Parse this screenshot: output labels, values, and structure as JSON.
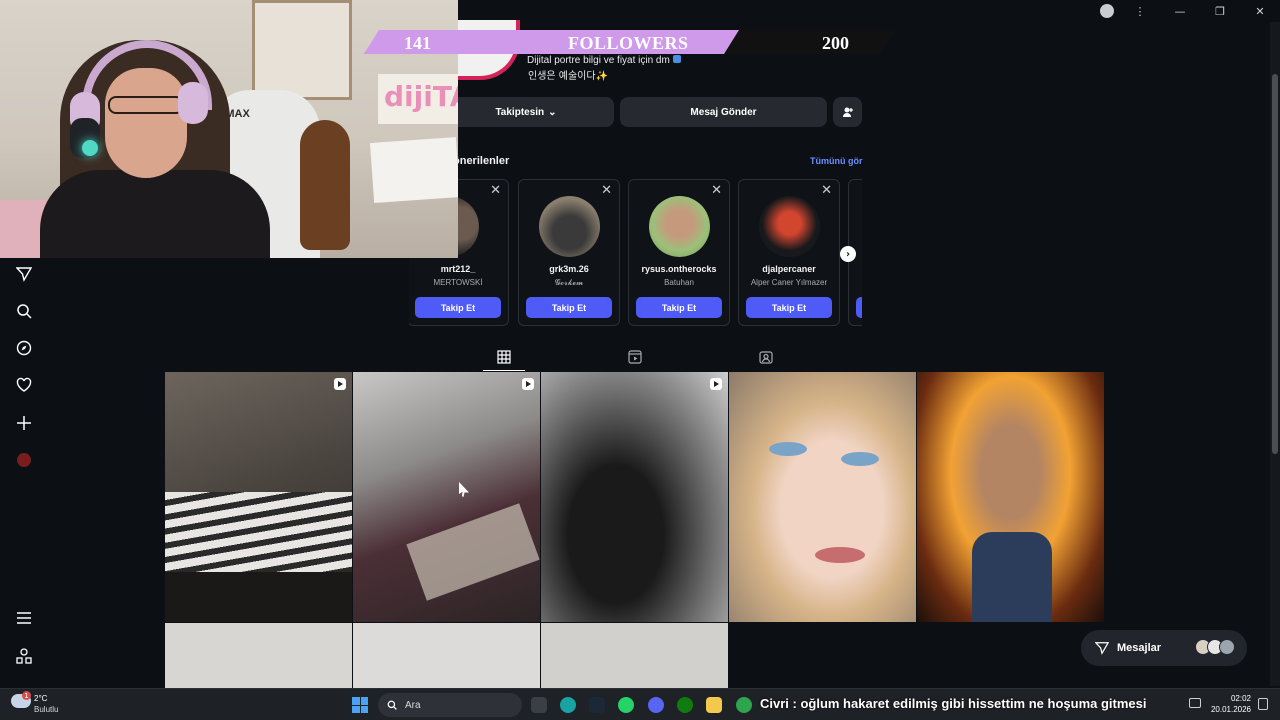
{
  "stream_overlay": {
    "followers_current": "141",
    "followers_label": "FOLLOWERS",
    "followers_goal": "200",
    "progress_fraction": 0.705,
    "fill_color": "#cf9aea",
    "webcam_chair_brand": "XMAX",
    "webcam_sign_text": "dijiTA"
  },
  "profile": {
    "bio_line1": "Dijital portre bilgi ve fiyat için dm",
    "bio_line2": "인생은 예술이다✨",
    "following_button": "Takiptesin",
    "message_button": "Mesaj Gönder",
    "add_user_icon": "add-user-icon"
  },
  "suggestions": {
    "title": "Önerilenler",
    "title_visible": "önerilenler",
    "see_all": "Tümünü gör",
    "follow_label": "Takip Et",
    "items": [
      {
        "username": "mrt212_",
        "name": "MERTOWSKİ"
      },
      {
        "username": "grk3m.26",
        "name": "𝓖𝓸𝓻𝓴𝓮𝓶"
      },
      {
        "username": "rysus.ontherocks",
        "name": "Batuhan"
      },
      {
        "username": "djalpercaner",
        "name": "Alper Caner Yılmazer"
      }
    ]
  },
  "tabs": [
    {
      "name": "posts-grid-icon",
      "active": true
    },
    {
      "name": "reels-icon",
      "active": false
    },
    {
      "name": "tagged-icon",
      "active": false
    }
  ],
  "sidebar_icons": [
    "direct-icon",
    "search-icon",
    "explore-icon",
    "heart-icon",
    "create-icon",
    "profile-icon",
    "menu-icon",
    "more-apps-icon"
  ],
  "messages": {
    "label": "Mesajlar"
  },
  "taskbar": {
    "temperature": "2°C",
    "condition": "Bulutlu",
    "weather_badge": "1",
    "search_placeholder": "Ara",
    "ticker": "Civri : oğlum hakaret edilmiş gibi hissettim ne hoşuma gitmesi",
    "time": "02:02",
    "date": "20.01.2026"
  },
  "colors": {
    "accent_blue": "#4f5bf6",
    "link_blue": "#6a8fff",
    "background": "#0c0f14"
  }
}
